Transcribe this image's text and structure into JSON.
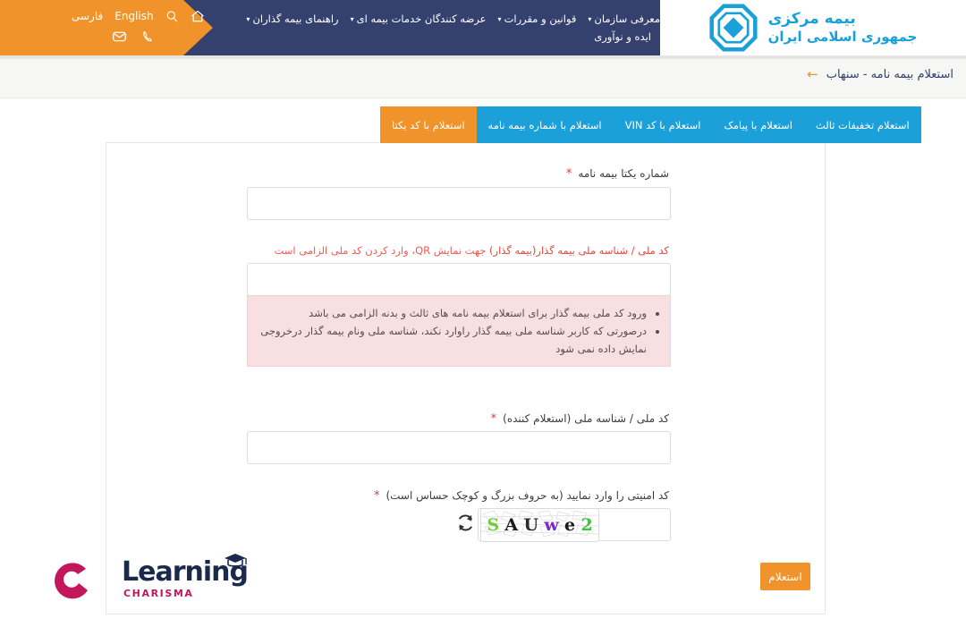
{
  "header": {
    "logo": {
      "line1": "بیمه مرکزی",
      "line2": "جمهوری اسلامی ایران",
      "mark_icon": "octagon-diamond-logo-icon",
      "color": "#18a0d8"
    },
    "nav_items": [
      {
        "label": "معرفی سازمان",
        "has_caret": true
      },
      {
        "label": "قوانین و مقررات",
        "has_caret": true
      },
      {
        "label": "عرضه کنندگان خدمات بیمه ای",
        "has_caret": true
      },
      {
        "label": "راهنمای بیمه گذاران",
        "has_caret": true
      },
      {
        "label": "ایده و نوآوری",
        "has_caret": false
      }
    ],
    "utility": {
      "home_icon": "home-icon",
      "search_icon": "search-icon",
      "english_label": "English",
      "farsi_label": "فارسی",
      "phone_icon": "phone-icon",
      "mail_icon": "envelope-icon"
    },
    "nav_bg": "#34416f",
    "utility_bg": "#f0932b"
  },
  "breadcrumb": {
    "arrow_icon": "arrow-left-icon",
    "title": "استعلام بیمه نامه - سنهاب"
  },
  "tabs": [
    {
      "label": "استعلام تخفیفات ثالث",
      "active": false
    },
    {
      "label": "استعلام با پیامک",
      "active": false
    },
    {
      "label": "استعلام با کد VIN",
      "active": false
    },
    {
      "label": "استعلام با شماره بیمه نامه",
      "active": false
    },
    {
      "label": "استعلام با کد یکتا",
      "active": true
    }
  ],
  "form": {
    "field_unique_number": {
      "label": "شماره یکتا بیمه نامه",
      "required_mark": "*",
      "value": "",
      "placeholder": ""
    },
    "field_national_id_insurer": {
      "label_part1": "کد ملی / شناسه ملی بیمه گذار(بیمه گذار) ",
      "label_part2": "جهت نمایش QR، وارد کردن کد ملی الزامی است",
      "value": "",
      "placeholder": ""
    },
    "info_box": {
      "bullets": [
        "ورود کد ملی بیمه گذار برای استعلام بیمه نامه های ثالث و بدنه الزامی می باشد",
        "درصورتی که کاربر شناسه ملی بیمه گذار راوارد نکند، شناسه ملی ونام بیمه گذار درخروجی نمایش داده نمی شود"
      ],
      "bg": "#f7dfe2"
    },
    "field_national_id_requester": {
      "label": "کد ملی / شناسه ملی (استعلام کننده)",
      "required_mark": "*",
      "value": "",
      "placeholder": ""
    },
    "field_captcha": {
      "label": "کد امنیتی را وارد نمایید (به حروف بزرگ و کوچک حساس است)",
      "required_mark": "*",
      "value": "",
      "placeholder": "",
      "refresh_icon": "refresh-icon",
      "captcha_chars": [
        {
          "ch": "2",
          "color": "#3ec43e"
        },
        {
          "ch": "e",
          "color": "#1a1a1a"
        },
        {
          "ch": "w",
          "color": "#7a28c4"
        },
        {
          "ch": "U",
          "color": "#2b2b2b"
        },
        {
          "ch": "A",
          "color": "#1a1a1a"
        },
        {
          "ch": "S",
          "color": "#6fcf3a"
        }
      ]
    },
    "submit_label": "استعلام",
    "submit_color": "#f0932b"
  },
  "watermark": {
    "word": "Learning",
    "sub": "CHARISMA",
    "arc_icon": "c-arc-icon",
    "cap_icon": "graduation-cap-icon",
    "arc_color": "#c2185b",
    "word_color": "#1b2a4a"
  }
}
